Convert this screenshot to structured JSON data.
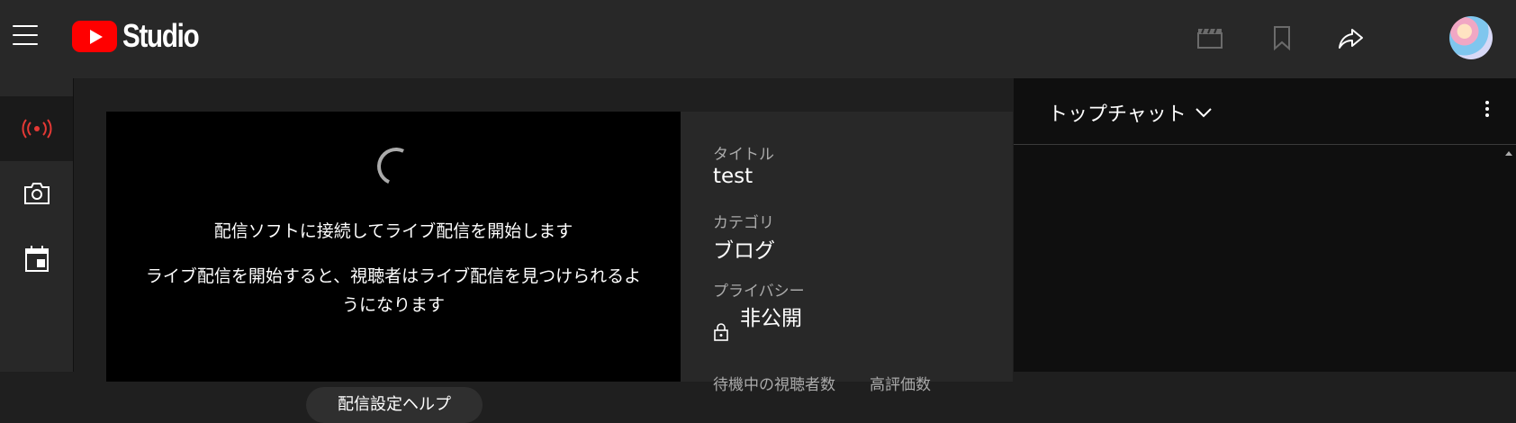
{
  "header": {
    "studio_label": "Studio",
    "icons": [
      "menu-icon",
      "clapperboard-icon",
      "bookmark-icon",
      "share-icon"
    ]
  },
  "rail": {
    "items": [
      "live-broadcast-icon",
      "camera-icon",
      "calendar-icon"
    ],
    "active": "live-broadcast-icon",
    "active_color": "#e53935"
  },
  "preview": {
    "message_primary": "配信ソフトに接続してライブ配信を開始します",
    "message_secondary": "ライブ配信を開始すると、視聴者はライブ配信を見つけられるようになります",
    "help_button": "配信設定ヘルプ"
  },
  "details": {
    "title_label": "タイトル",
    "title_value": "test",
    "category_label": "カテゴリ",
    "category_value": "ブログ",
    "privacy_label": "プライバシー",
    "privacy_value": "非公開",
    "stat1_label": "待機中の視聴者数",
    "stat2_label": "高評価数"
  },
  "chat": {
    "title": "トップチャット"
  },
  "colors": {
    "brand_red": "#ff0000",
    "header_bg": "#282828",
    "chat_bg": "#0f0f0f"
  }
}
